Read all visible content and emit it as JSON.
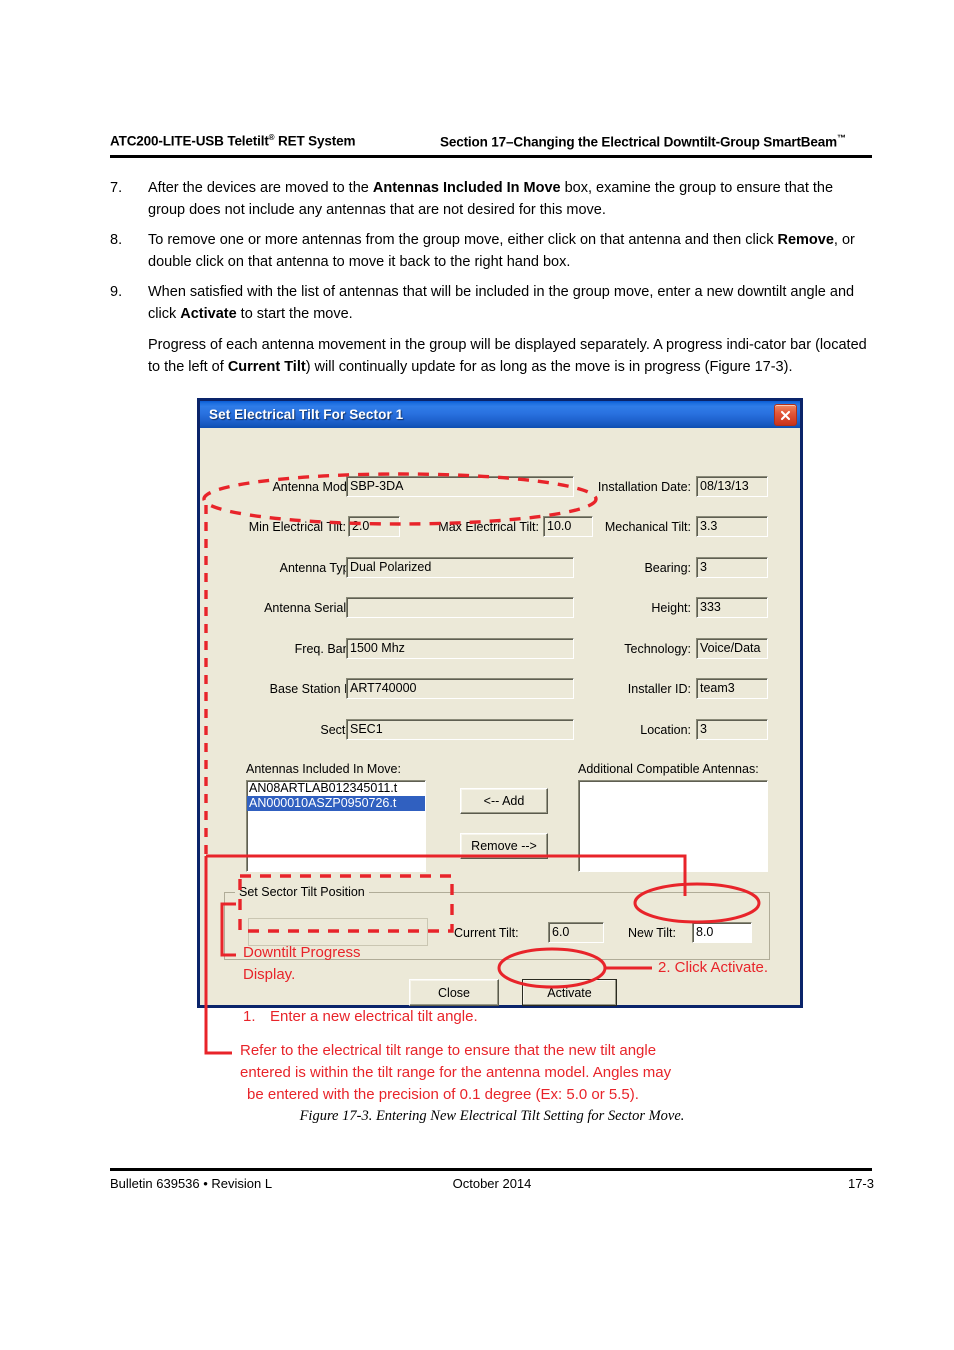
{
  "header": {
    "left_product": "ATC200-LITE-USB Teletilt",
    "left_reg": "®",
    "left_suffix": " RET System",
    "right_section": "Section 17–Changing the Electrical Downtilt-Group SmartBeam",
    "right_tm": "™"
  },
  "steps": [
    {
      "num": "7.",
      "parts": [
        {
          "t": "After the devices are moved to the ",
          "b": false
        },
        {
          "t": "Antennas Included In Move",
          "b": true
        },
        {
          "t": " box, examine the group to ensure that the group does not include any antennas that are not desired for this move.",
          "b": false
        }
      ]
    },
    {
      "num": "8.",
      "parts": [
        {
          "t": "To remove one or more antennas from the group move, either click on that antenna and then click ",
          "b": false
        },
        {
          "t": "Remove",
          "b": true
        },
        {
          "t": ", or double click on that antenna to move it back to the right hand box.",
          "b": false
        }
      ]
    },
    {
      "num": "9.",
      "parts": [
        {
          "t": "When satisfied with the list of antennas that will be included in the group move, enter a new downtilt angle and click ",
          "b": false
        },
        {
          "t": "Activate",
          "b": true
        },
        {
          "t": " to start the move.",
          "b": false
        }
      ]
    }
  ],
  "paragraph": [
    {
      "t": "Progress of each antenna movement in the group will be displayed separately. A progress indi-cator bar (located to the left of ",
      "b": false
    },
    {
      "t": "Current Tilt",
      "b": true
    },
    {
      "t": ") will continually update for as long as the move is in progress (Figure 17-3).",
      "b": false
    }
  ],
  "dialog": {
    "title": "Set Electrical Tilt For Sector 1",
    "close_icon": "close-icon",
    "fields": {
      "antenna_model_label": "Antenna Model:",
      "antenna_model_value": "SBP-3DA",
      "installation_date_label": "Installation Date:",
      "installation_date_value": "08/13/13",
      "min_electrical_tilt_label": "Min Electrical Tilt:",
      "min_electrical_tilt_value": "2.0",
      "max_electrical_tilt_label": "Max Electrical Tilt:",
      "max_electrical_tilt_value": "10.0",
      "mechanical_tilt_label": "Mechanical Tilt:",
      "mechanical_tilt_value": "3.3",
      "antenna_type_label": "Antenna Type:",
      "antenna_type_value": "Dual Polarized",
      "bearing_label": "Bearing:",
      "bearing_value": "3",
      "antenna_serial_label": "Antenna Serial #:",
      "antenna_serial_value": "",
      "height_label": "Height:",
      "height_value": "333",
      "freq_band_label": "Freq. Band:",
      "freq_band_value": "1500  Mhz",
      "technology_label": "Technology:",
      "technology_value": "Voice/Data",
      "base_station_id_label": "Base Station ID:",
      "base_station_id_value": "ART740000",
      "installer_id_label": "Installer ID:",
      "installer_id_value": "team3",
      "sector_label": "Sector:",
      "sector_value": "SEC1",
      "location_label": "Location:",
      "location_value": "3"
    },
    "lists": {
      "included_label": "Antennas Included In Move:",
      "included_items": [
        "AN08ARTLAB012345011.t",
        "AN000010ASZP0950726.t"
      ],
      "selected_index": 1,
      "additional_label": "Additional Compatible Antennas:",
      "additional_items": []
    },
    "transfer_buttons": {
      "add": "<-- Add",
      "remove": "Remove -->"
    },
    "tilt_group": {
      "title": "Set Sector Tilt Position",
      "current_tilt_label": "Current Tilt:",
      "current_tilt_value": "6.0",
      "new_tilt_label": "New Tilt:",
      "new_tilt_value": "8.0",
      "progress_value": ""
    },
    "buttons": {
      "close": "Close",
      "activate": "Activate"
    }
  },
  "annotations": {
    "downtilt_progress_line1": "Downtilt Progress",
    "downtilt_progress_line2": "Display.",
    "click_activate": "2. Click Activate.",
    "step1_num": "1.",
    "step1_text": "Enter a new electrical tilt angle.",
    "note_line1": "Refer to the electrical tilt range to ensure that the new tilt angle",
    "note_line2": "entered is within the tilt range for the antenna model. Angles may",
    "note_line3": "be entered with the precision of 0.1 degree (Ex: 5.0 or 5.5).",
    "color": "#e8242a"
  },
  "caption": "Figure 17-3. Entering New Electrical Tilt Setting for Sector Move.",
  "footer": {
    "left": "Bulletin 639536  •  Revision L",
    "center": "October 2014",
    "right": "17-3"
  }
}
